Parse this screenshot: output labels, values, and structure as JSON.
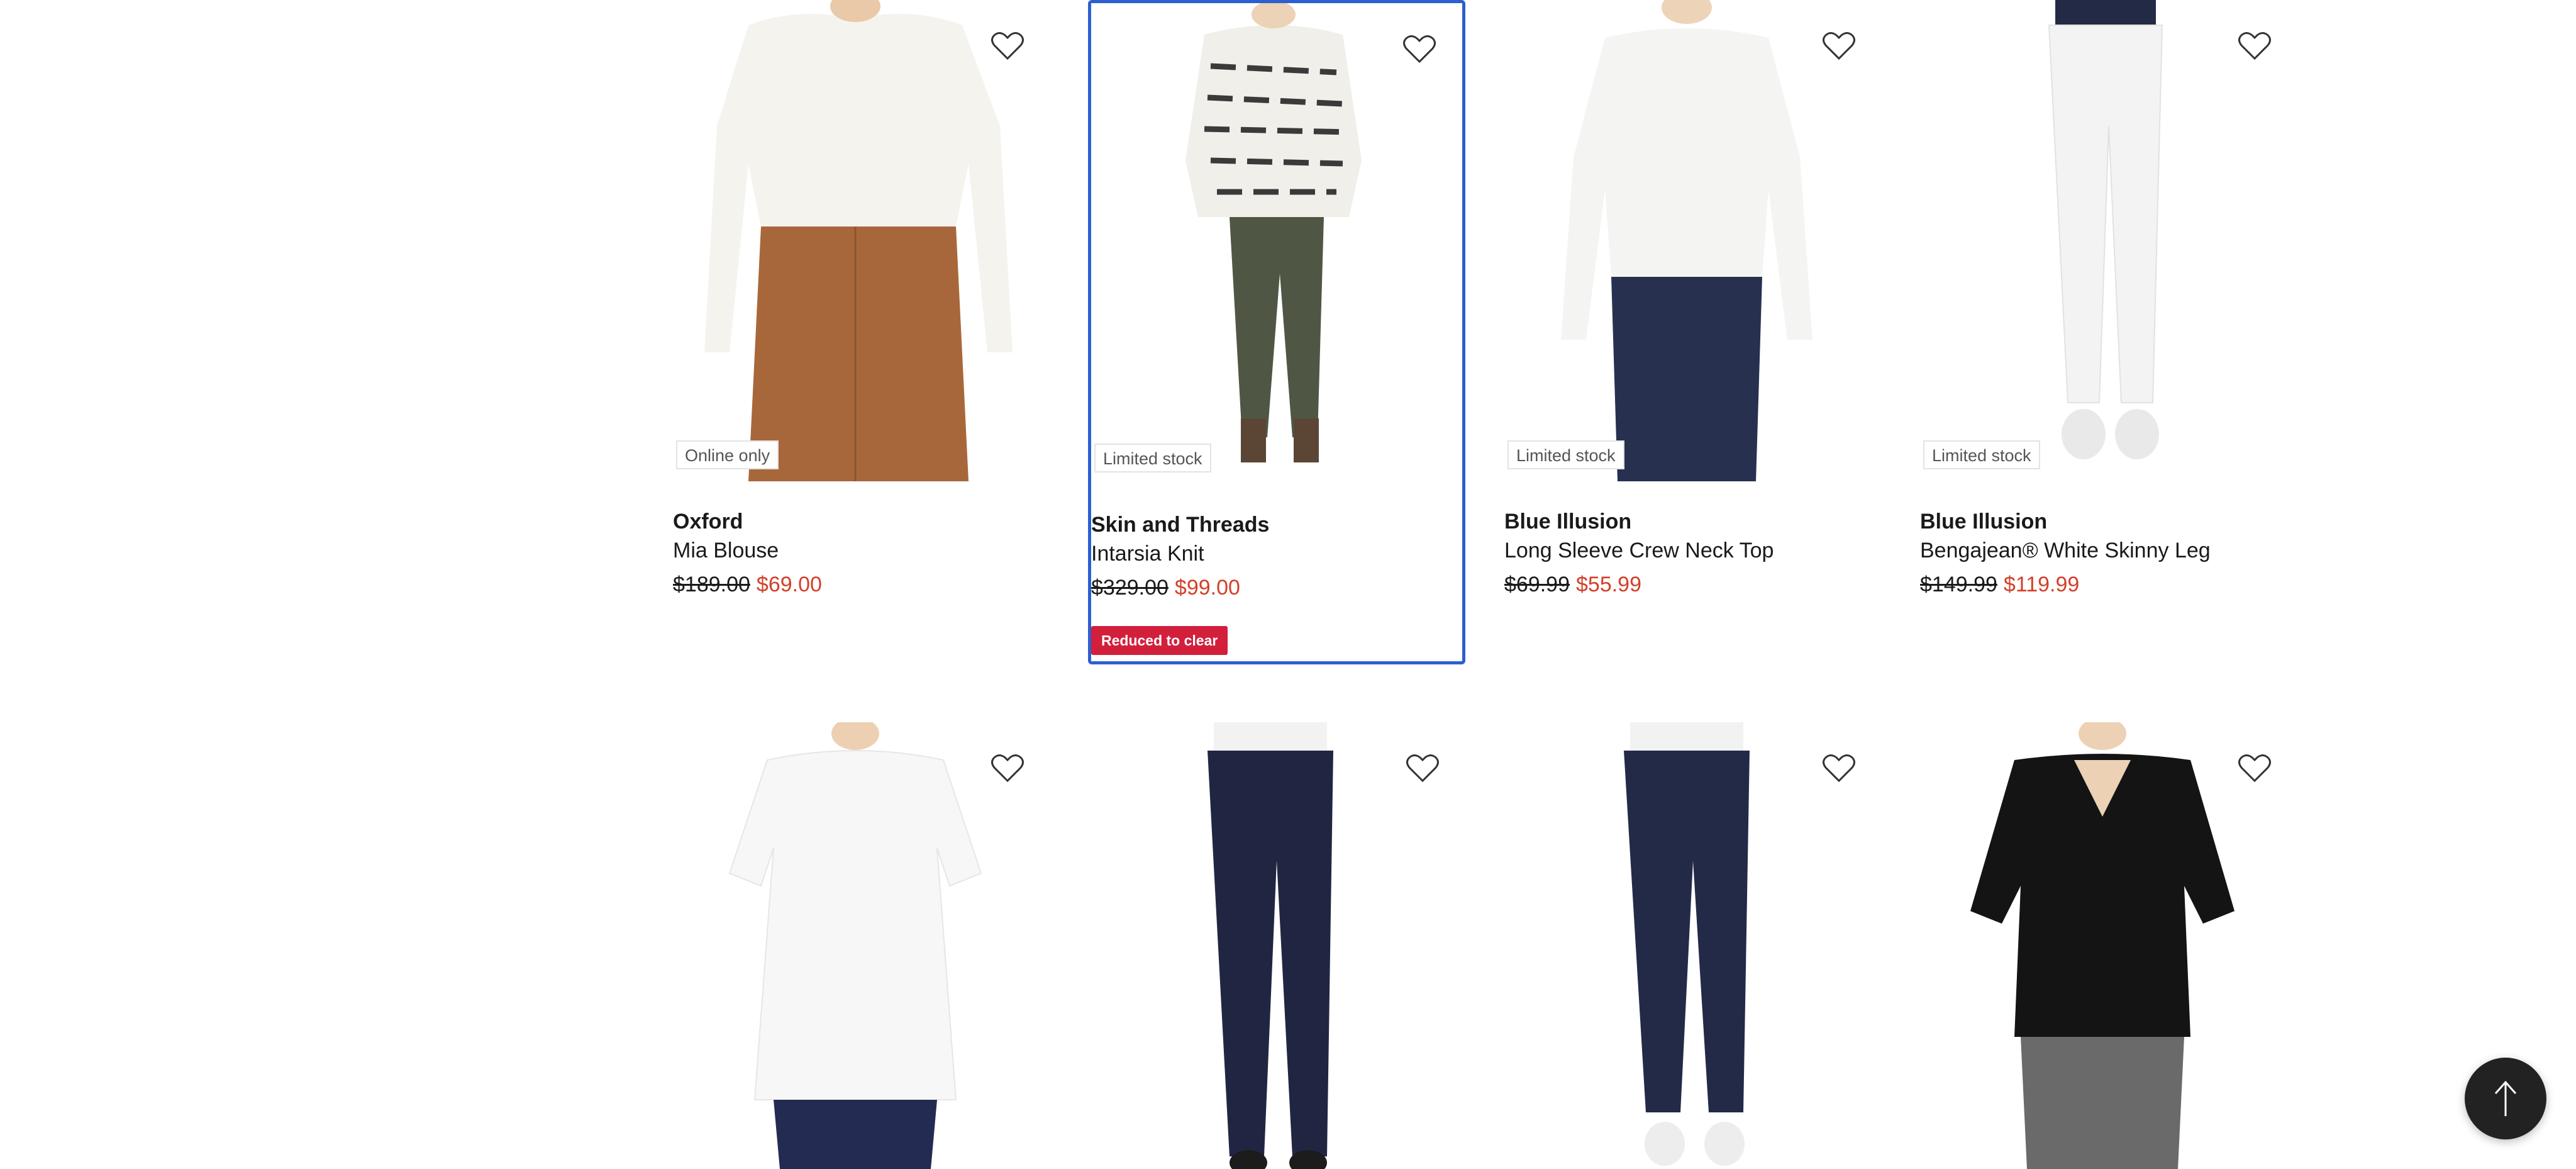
{
  "products": [
    {
      "badge": "Online only",
      "brand": "Oxford",
      "name": "Mia Blouse",
      "was": "$189.00",
      "now": "$69.00",
      "image": "mia-blouse-image",
      "promo": ""
    },
    {
      "badge": "Limited stock",
      "brand": "Skin and Threads",
      "name": "Intarsia Knit",
      "was": "$329.00",
      "now": "$99.00",
      "image": "intarsia-knit-image",
      "promo": "Reduced to clear"
    },
    {
      "badge": "Limited stock",
      "brand": "Blue Illusion",
      "name": "Long Sleeve Crew Neck Top",
      "was": "$69.99",
      "now": "$55.99",
      "image": "crew-neck-top-image",
      "promo": ""
    },
    {
      "badge": "Limited stock",
      "brand": "Blue Illusion",
      "name": "Bengajean® White Skinny Leg",
      "was": "$149.99",
      "now": "$119.99",
      "image": "white-skinny-leg-image",
      "promo": ""
    },
    {
      "image": "white-tshirt-image"
    },
    {
      "image": "navy-pull-on-jean-image"
    },
    {
      "image": "navy-crop-jean-image"
    },
    {
      "image": "black-vneck-tee-image"
    }
  ],
  "icons": {
    "favourite": "heart-outline-icon",
    "back_to_top": "arrow-up-icon"
  },
  "colors": {
    "sale_price": "#d2402a",
    "promo_badge": "#d21f3c",
    "focus_outline": "#2c5fd0"
  }
}
